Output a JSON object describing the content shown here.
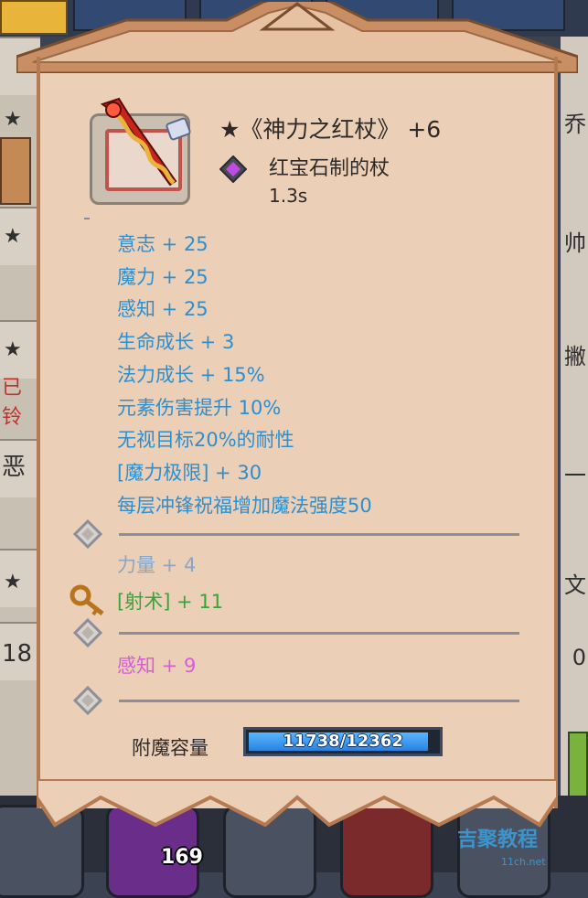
{
  "background": {
    "left_column": [
      "★",
      "★",
      "★",
      "已铃",
      "恶",
      "★",
      "18"
    ],
    "right_column": [
      "乔",
      "帅",
      "撇",
      "一",
      "文",
      "0"
    ],
    "slot_count": "169",
    "watermark": "吉聚教程",
    "watermark_sub": "11ch.net"
  },
  "tooltip": {
    "title": "★《神力之红杖》 +6",
    "subtitle": "红宝石制的杖",
    "speed": "1.3s",
    "stats": [
      "意志 + 25",
      "魔力 + 25",
      "感知 + 25",
      "生命成长 + 3",
      "法力成长 + 15%",
      "元素伤害提升 10%",
      "无视目标20%的耐性",
      "[魔力极限] + 30",
      "每层冲锋祝福增加魔法强度50"
    ],
    "socket_bonus_1": "力量 + 4",
    "socket_bonus_archery": "[射术] + 11",
    "socket_bonus_2": "感知 + 9",
    "enchant_label": "附魔容量",
    "enchant_value": "11738/12362",
    "enchant_fraction": 0.9495
  },
  "colors": {
    "paper": "#eccfb7",
    "stat_blue": "#2c8fd0",
    "archery_green": "#3aa33a",
    "pink": "#d55fd3",
    "faded_blue": "#8aa6c2",
    "bar_blue": "#2a82e0"
  }
}
